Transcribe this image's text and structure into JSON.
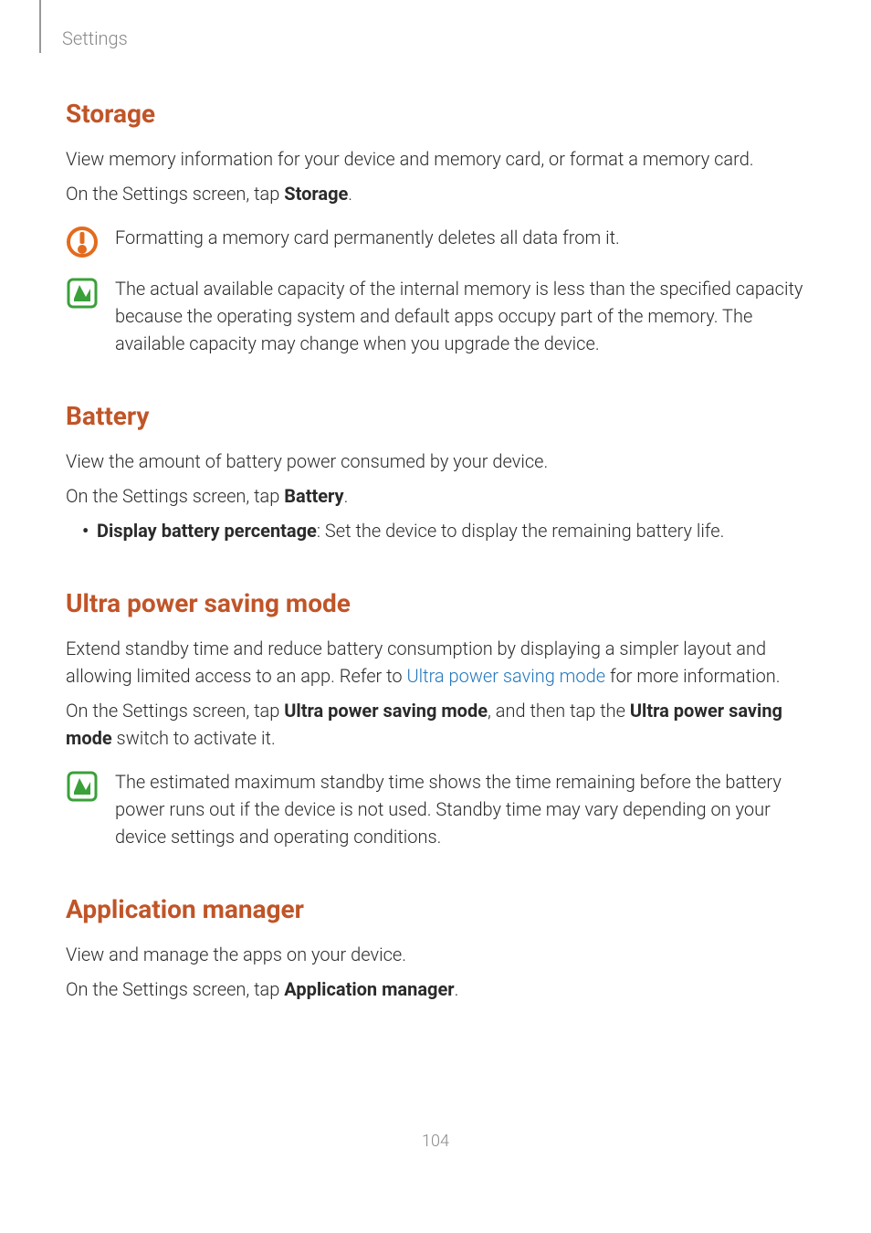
{
  "header": "Settings",
  "page_number": "104",
  "sections": {
    "storage": {
      "title": "Storage",
      "p1": "View memory information for your device and memory card, or format a memory card.",
      "p2_pre": "On the Settings screen, tap ",
      "p2_bold": "Storage",
      "p2_post": ".",
      "caution": "Formatting a memory card permanently deletes all data from it.",
      "info": "The actual available capacity of the internal memory is less than the specified capacity because the operating system and default apps occupy part of the memory. The available capacity may change when you upgrade the device."
    },
    "battery": {
      "title": "Battery",
      "p1": "View the amount of battery power consumed by your device.",
      "p2_pre": "On the Settings screen, tap ",
      "p2_bold": "Battery",
      "p2_post": ".",
      "bullet_bold": "Display battery percentage",
      "bullet_rest": ": Set the device to display the remaining battery life."
    },
    "ultra": {
      "title": "Ultra power saving mode",
      "p1_pre": "Extend standby time and reduce battery consumption by displaying a simpler layout and allowing limited access to an app. Refer to ",
      "p1_link": "Ultra power saving mode",
      "p1_post": " for more information.",
      "p2_pre": "On the Settings screen, tap ",
      "p2_bold1": "Ultra power saving mode",
      "p2_mid": ", and then tap the ",
      "p2_bold2": "Ultra power saving mode",
      "p2_post": " switch to activate it.",
      "info": "The estimated maximum standby time shows the time remaining before the battery power runs out if the device is not used. Standby time may vary depending on your device settings and operating conditions."
    },
    "appmgr": {
      "title": "Application manager",
      "p1": "View and manage the apps on your device.",
      "p2_pre": "On the Settings screen, tap ",
      "p2_bold": "Application manager",
      "p2_post": "."
    }
  }
}
